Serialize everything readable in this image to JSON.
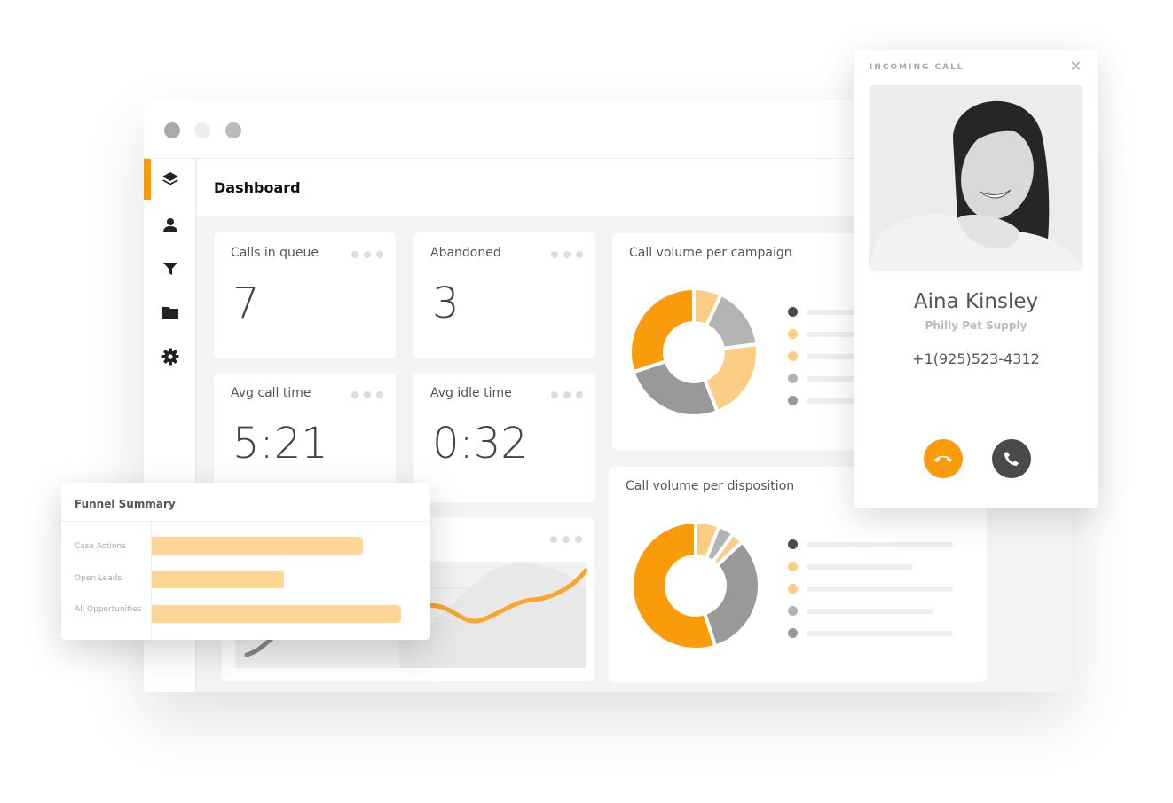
{
  "window": {
    "controls": [
      "close",
      "minimize",
      "maximize"
    ]
  },
  "sidebar": {
    "items": [
      {
        "icon": "layers-icon",
        "active": true
      },
      {
        "icon": "user-icon"
      },
      {
        "icon": "filter-icon"
      },
      {
        "icon": "folder-icon"
      },
      {
        "icon": "gear-icon"
      }
    ]
  },
  "header": {
    "title": "Dashboard"
  },
  "stats": [
    {
      "label": "Calls in queue",
      "value": "7"
    },
    {
      "label": "Abandoned",
      "value": "3"
    },
    {
      "label": "Avg call time",
      "value": "5:21"
    },
    {
      "label": "Avg idle time",
      "value": "0:32"
    }
  ],
  "campaign_chart": {
    "title": "Call volume per campaign",
    "type": "donut",
    "slices": [
      7,
      16,
      21,
      26,
      30
    ],
    "slice_colors": [
      "#fdcd85",
      "#b3b3b3",
      "#fdcd85",
      "#999999",
      "#fa9c0a"
    ],
    "legend_colors": [
      "#4a4a4a",
      "#fdcd85",
      "#fdcd85",
      "#b3b3b3",
      "#999999"
    ]
  },
  "disposition_chart": {
    "title": "Call volume per disposition",
    "type": "donut",
    "slices": [
      6,
      4,
      3,
      32,
      55
    ],
    "slice_colors": [
      "#fdcd85",
      "#b3b3b3",
      "#fdcd85",
      "#999999",
      "#fa9c0a"
    ],
    "legend_colors": [
      "#4a4a4a",
      "#fdcd85",
      "#fdcd85",
      "#b3b3b3",
      "#999999"
    ]
  },
  "funnel": {
    "title": "Funnel Summary",
    "rows": [
      {
        "label": "Case Actions",
        "value": 0.72
      },
      {
        "label": "Open Leads",
        "value": 0.45
      },
      {
        "label": "All Opportunities",
        "value": 0.85
      }
    ]
  },
  "incoming_call": {
    "heading": "INCOMING CALL",
    "name": "Aina Kinsley",
    "company": "Philly Pet Supply",
    "phone": "+1(925)523-4312"
  },
  "colors": {
    "accent": "#fa9c0a",
    "accent_light": "#fed594",
    "dark": "#4a4a4a"
  }
}
